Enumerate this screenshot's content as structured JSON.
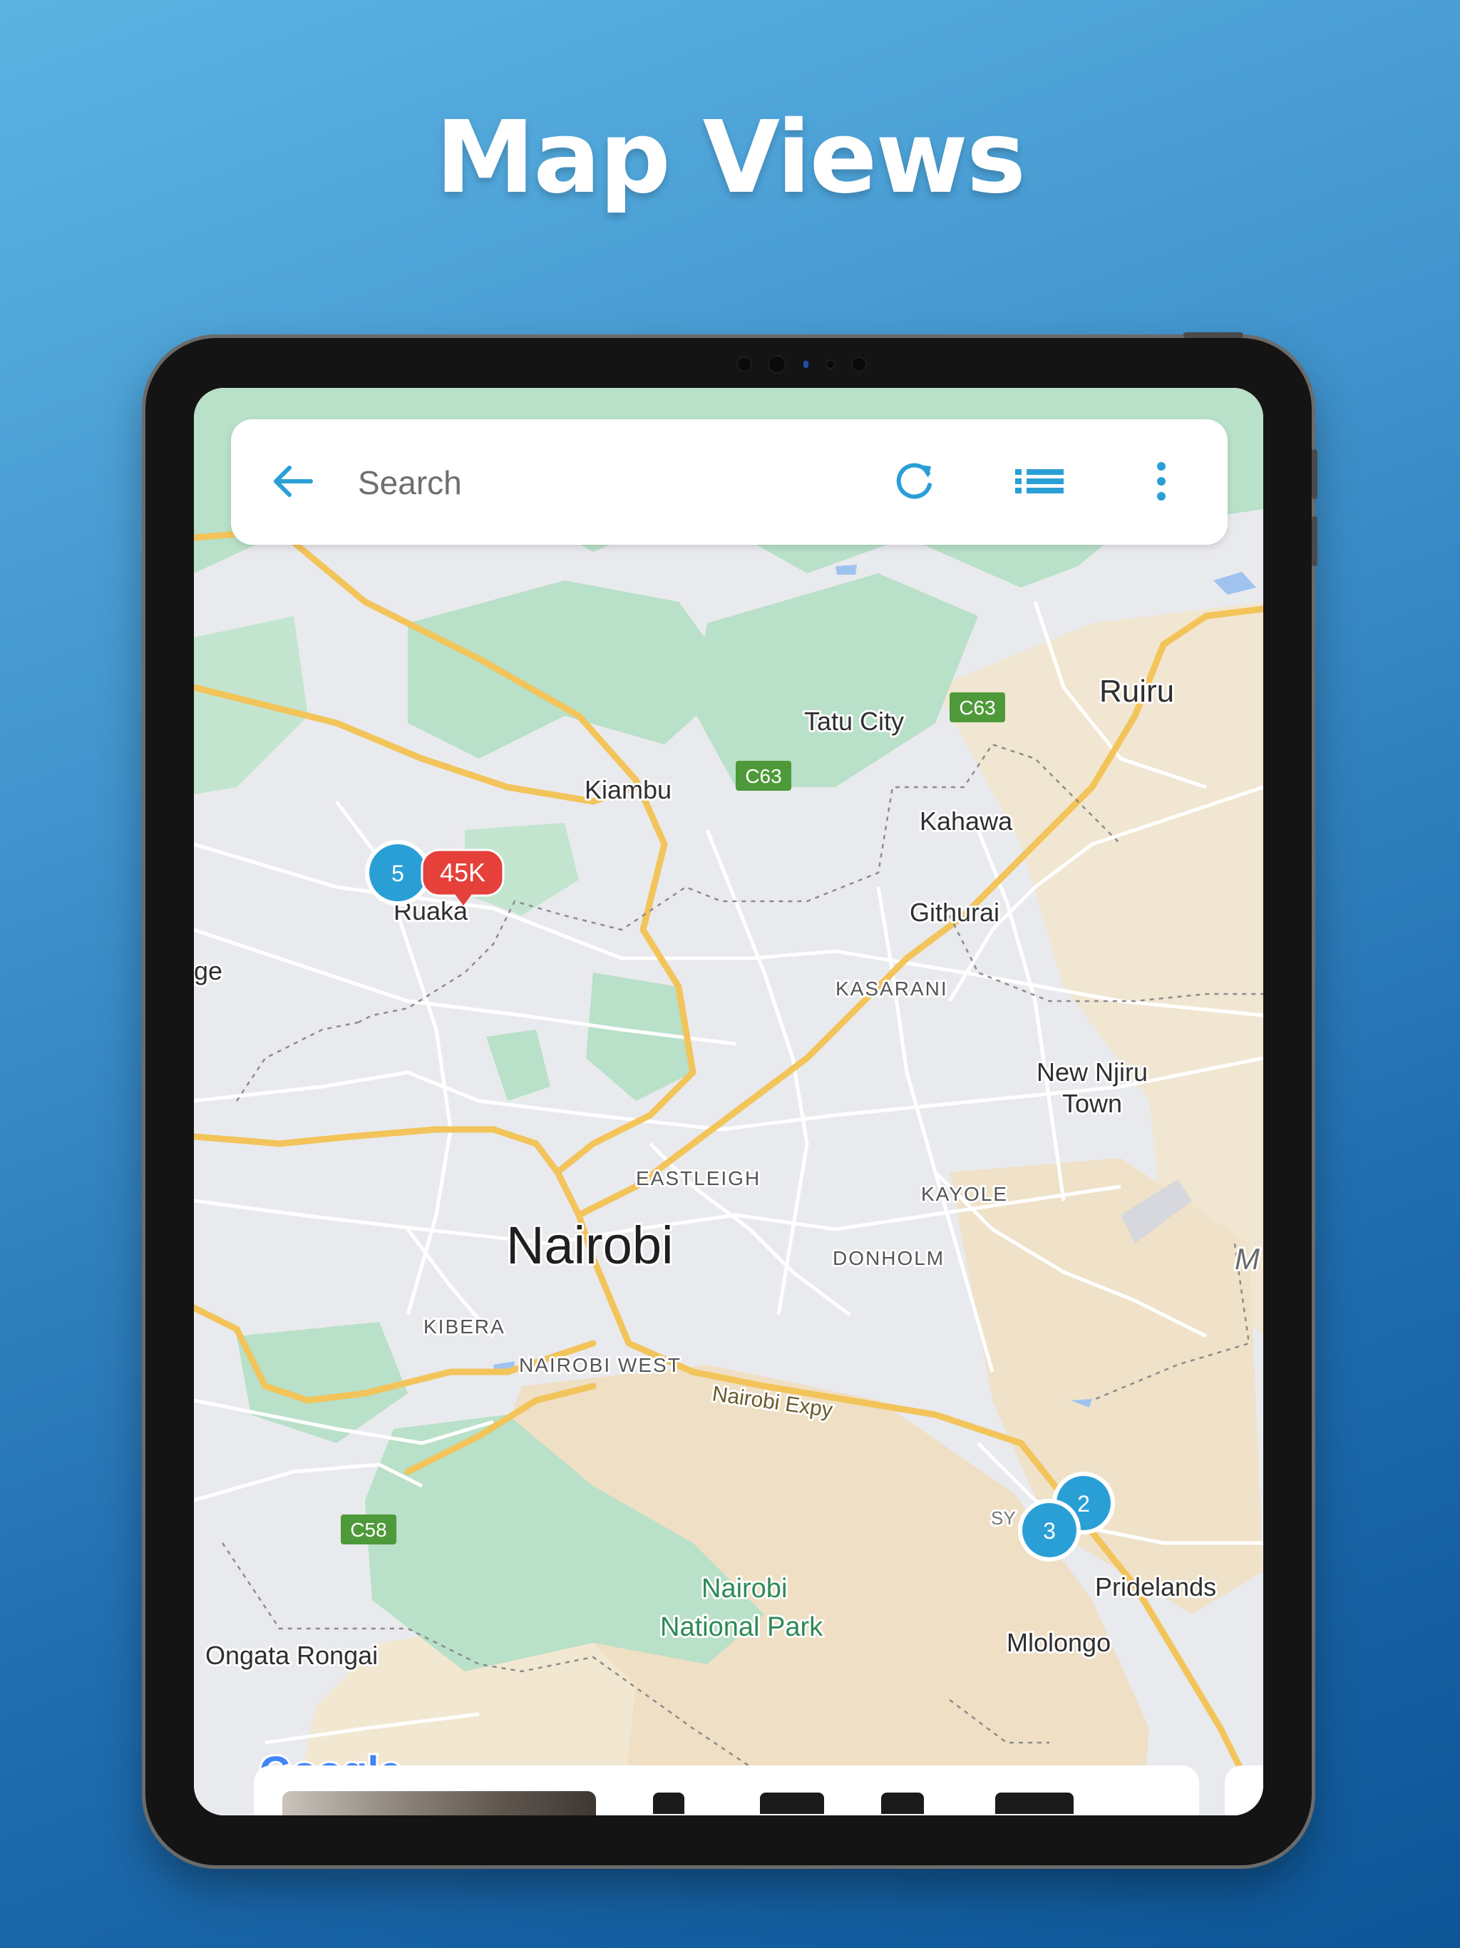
{
  "headline": "Map Views",
  "search": {
    "placeholder": "Search",
    "back_icon": "arrow-left-icon",
    "refresh_icon": "refresh-icon",
    "list_icon": "list-view-icon",
    "menu_icon": "more-vert-icon"
  },
  "map": {
    "places": {
      "ruiru": "Ruiru",
      "tatu_city": "Tatu City",
      "kiambu": "Kiambu",
      "kahawa": "Kahawa",
      "ruaka": "Ruaka",
      "githurai": "Githurai",
      "ge": "ge",
      "kasarani": "KASARANI",
      "new_njiru_1": "New Njiru",
      "new_njiru_2": "Town",
      "eastleigh": "EASTLEIGH",
      "kayole": "KAYOLE",
      "nairobi": "Nairobi",
      "donholm": "DONHOLM",
      "m_edge": "M",
      "kibera": "KIBERA",
      "nairobi_west": "NAIROBI WEST",
      "expy": "Nairobi Expy",
      "park_1": "Nairobi",
      "park_2": "National Park",
      "pridelands": "Pridelands",
      "ongata_rongai": "Ongata Rongai",
      "mlolongo": "Mlolongo",
      "sy": "SY",
      "google": "Google"
    },
    "road_shields": {
      "c63_a": "C63",
      "c63_b": "C63",
      "c58": "C58"
    },
    "markers": {
      "cluster_ruaka": "5",
      "price_ruaka": "45K",
      "cluster_south_a": "2",
      "cluster_south_b": "3"
    },
    "colors": {
      "accent": "#2a9fd6",
      "price_marker": "#e5403a",
      "green": "#b9e0c8",
      "tan": "#efe2c9",
      "road_major": "#f2c45a"
    }
  }
}
